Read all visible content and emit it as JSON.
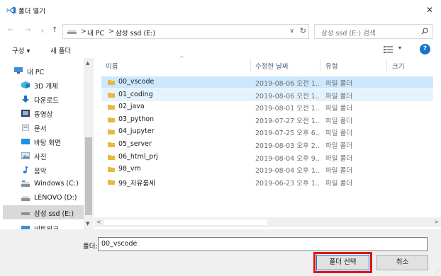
{
  "window": {
    "title": "폴더 열기",
    "close_glyph": "✕"
  },
  "nav": {
    "back": "←",
    "forward": "→",
    "recent": "∨",
    "up": "↑"
  },
  "address": {
    "crumbs": [
      "내 PC",
      "삼성 ssd (E:)"
    ],
    "sep": ">",
    "dropdown": "∨",
    "refresh": "↻"
  },
  "search": {
    "placeholder": "삼성 ssd (E:) 검색"
  },
  "command_bar": {
    "organize": "구성 ▾",
    "new_folder": "새 폴더",
    "view_caret": "▾",
    "help": "?"
  },
  "nav_pane": {
    "items": [
      {
        "label": "내 PC",
        "icon": "pc-icon"
      },
      {
        "label": "3D 개체",
        "icon": "3d-objects-icon"
      },
      {
        "label": "다운로드",
        "icon": "download-icon"
      },
      {
        "label": "동영상",
        "icon": "video-icon"
      },
      {
        "label": "문서",
        "icon": "document-icon"
      },
      {
        "label": "바탕 화면",
        "icon": "desktop-icon"
      },
      {
        "label": "사진",
        "icon": "pictures-icon"
      },
      {
        "label": "음악",
        "icon": "music-icon"
      },
      {
        "label": "Windows (C:)",
        "icon": "drive-icon"
      },
      {
        "label": "LENOVO (D:)",
        "icon": "drive-icon"
      },
      {
        "label": "삼성 ssd (E:)",
        "icon": "drive-icon"
      },
      {
        "label": "네트워크",
        "icon": "network-icon"
      }
    ],
    "selected_index": 10,
    "scroll_up": "▲",
    "scroll_down": "▼"
  },
  "columns": {
    "name": "이름",
    "modified": "수정한 날짜",
    "type": "유형",
    "size": "크기",
    "sort_caret": "^"
  },
  "rows": [
    {
      "name": "00_vscode",
      "date": "2019-08-06 오전 1...",
      "type": "파일 폴더"
    },
    {
      "name": "01_coding",
      "date": "2019-08-06 오전 1...",
      "type": "파일 폴더"
    },
    {
      "name": "02_java",
      "date": "2019-08-01 오전 1...",
      "type": "파일 폴더"
    },
    {
      "name": "03_python",
      "date": "2019-07-27 오전 1...",
      "type": "파일 폴더"
    },
    {
      "name": "04_jupyter",
      "date": "2019-07-25 오후 6...",
      "type": "파일 폴더"
    },
    {
      "name": "05_server",
      "date": "2019-08-03 오후 2...",
      "type": "파일 폴더"
    },
    {
      "name": "06_html_prj",
      "date": "2019-08-04 오후 9...",
      "type": "파일 폴더"
    },
    {
      "name": "98_vm",
      "date": "2019-08-04 오후 1...",
      "type": "파일 폴더"
    },
    {
      "name": "99_자유룸세",
      "date": "2019-06-23 오후 1...",
      "type": "파일 폴더"
    }
  ],
  "hscroll": {
    "left": "<",
    "right": ">"
  },
  "bottom": {
    "folder_label": "폴더:",
    "folder_value": "00_vscode",
    "select_button": "폴더 선택",
    "cancel_button": "취소"
  },
  "colors": {
    "selected_row": "#cce8ff",
    "accent": "#0078d7",
    "highlight": "#e2131a",
    "folder": "#e8b93d"
  }
}
